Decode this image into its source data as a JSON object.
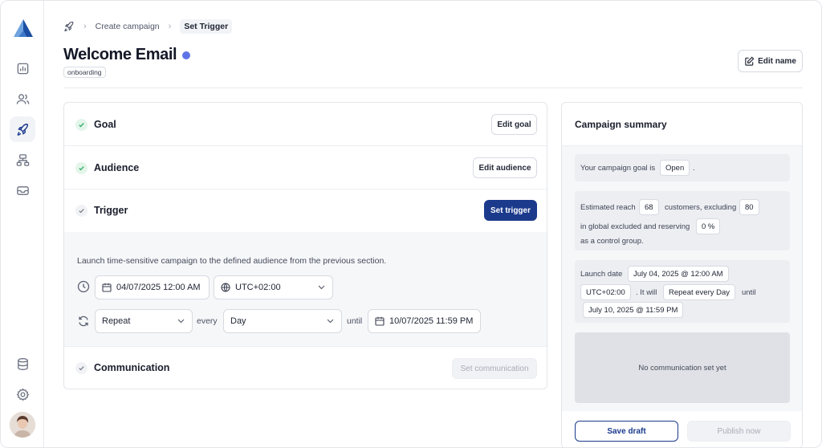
{
  "breadcrumb": {
    "items": [
      "Create campaign",
      "Set Trigger"
    ]
  },
  "header": {
    "title": "Welcome Email",
    "tag": "onboarding",
    "edit_name": "Edit name",
    "status_color": "#5f73e8"
  },
  "steps": {
    "goal": {
      "title": "Goal",
      "button": "Edit goal"
    },
    "audience": {
      "title": "Audience",
      "button": "Edit audience"
    },
    "trigger": {
      "title": "Trigger",
      "button": "Set trigger"
    },
    "communication": {
      "title": "Communication",
      "button": "Set communication"
    }
  },
  "trigger_form": {
    "description": "Launch time-sensitive campaign to the defined audience from the previous section.",
    "launch_date": "04/07/2025 12:00 AM",
    "timezone": "UTC+02:00",
    "repeat": "Repeat",
    "every_label": "every",
    "interval": "Day",
    "until_label": "until",
    "end_date": "10/07/2025 11:59 PM"
  },
  "summary": {
    "title": "Campaign summary",
    "goal": {
      "prefix": "Your campaign goal is",
      "value": "Open",
      "suffix": "."
    },
    "reach": {
      "prefix": "Estimated reach",
      "reach_value": "68",
      "mid": "customers, excluding",
      "excluded_value": "80",
      "line2": "in global excluded and reserving",
      "control_value": "0 %",
      "line3": "as a control group."
    },
    "launch": {
      "prefix": "Launch date",
      "date": "July 04, 2025 @ 12:00 AM",
      "timezone": "UTC+02:00",
      "it_will": ". It will",
      "repeat": "Repeat every Day",
      "until": "until",
      "end_date": "July 10, 2025 @ 11:59 PM"
    },
    "no_communication": "No communication set yet",
    "save_draft": "Save draft",
    "publish_now": "Publish now"
  },
  "colors": {
    "primary": "#1b3a8c",
    "success": "#3cb371",
    "logo_light": "#6ea3e0",
    "logo_dark": "#1b4fa3"
  }
}
